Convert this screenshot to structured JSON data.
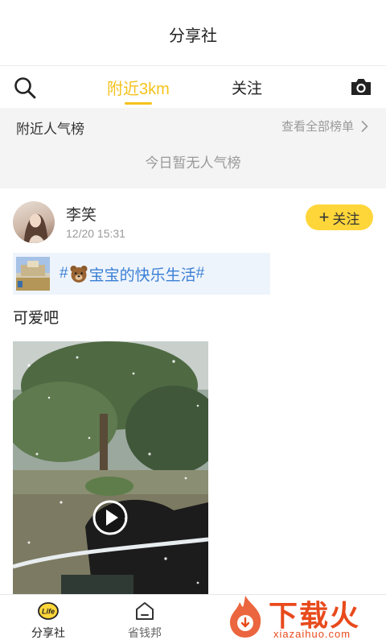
{
  "header": {
    "title": "分享社"
  },
  "tabs": {
    "nearby_label": "附近3km",
    "follow_label": "关注",
    "active_color": "#f4c21b"
  },
  "popular": {
    "title": "附近人气榜",
    "more_label": "查看全部榜单",
    "empty_text": "今日暂无人气榜"
  },
  "post": {
    "username": "李笑",
    "time": "12/20 15:31",
    "follow_label": "关注",
    "topic_prefix": "#",
    "topic_name": "宝宝的快乐生活",
    "topic_suffix": "#",
    "caption": "可爱吧",
    "media_type": "video"
  },
  "bottom_nav": {
    "items": [
      {
        "label": "分享社",
        "icon": "life-icon"
      },
      {
        "label": "省钱邦",
        "icon": "house-icon"
      }
    ]
  },
  "watermark": {
    "title": "下载火",
    "url": "xiazaihuo.com"
  },
  "colors": {
    "accent": "#ffd63a",
    "topic_blue": "#3a7fd5",
    "watermark_red": "#e84a1c"
  }
}
